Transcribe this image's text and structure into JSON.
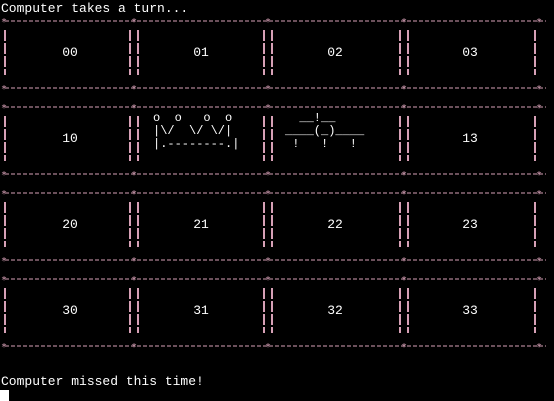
{
  "terminal": {
    "status_top": "Computer takes a turn...",
    "status_bottom": "Computer missed this time!",
    "separator_color": "#d6a0b6",
    "text_color": "#ffffff",
    "background": "#000000"
  },
  "board": {
    "rows": [
      [
        "00",
        "01",
        "02",
        "03"
      ],
      [
        "10",
        "",
        "",
        "13"
      ],
      [
        "20",
        "21",
        "22",
        "23"
      ],
      [
        "30",
        "31",
        "32",
        "33"
      ]
    ],
    "cell_11_art": "o  o   o  o\n|\\/  \\/ \\/|\n|.--------.|",
    "cell_12_art": "  __!__\n____(_)____\n !   !   !"
  }
}
